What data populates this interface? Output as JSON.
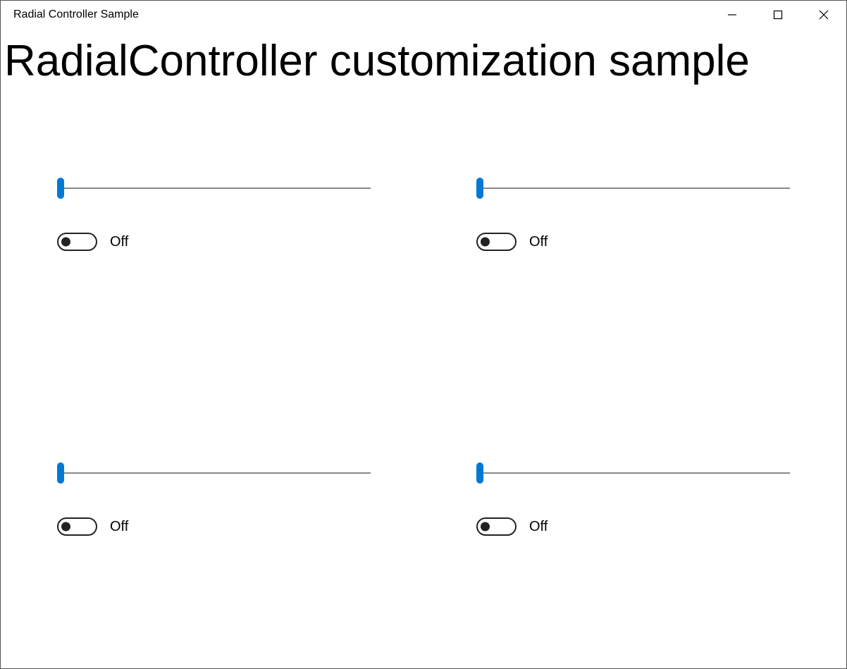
{
  "window": {
    "title": "Radial Controller Sample"
  },
  "page": {
    "heading": "RadialController customization sample"
  },
  "controls": [
    {
      "slider_value": 0,
      "toggle_on": false,
      "toggle_label": "Off"
    },
    {
      "slider_value": 0,
      "toggle_on": false,
      "toggle_label": "Off"
    },
    {
      "slider_value": 0,
      "toggle_on": false,
      "toggle_label": "Off"
    },
    {
      "slider_value": 0,
      "toggle_on": false,
      "toggle_label": "Off"
    }
  ],
  "colors": {
    "accent": "#0078d4"
  }
}
